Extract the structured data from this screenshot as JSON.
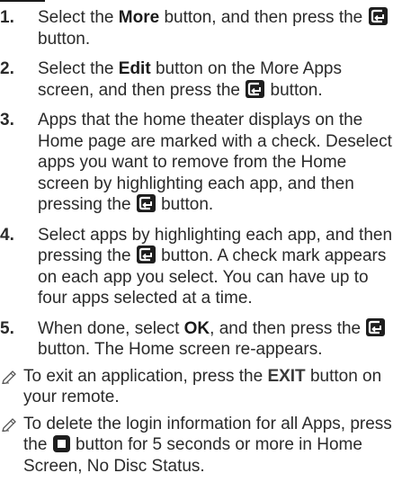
{
  "steps": [
    {
      "number": "1.",
      "p1": "Select the ",
      "b1": "More",
      "p2": " button, and then press the ",
      "p3": " button."
    },
    {
      "number": "2.",
      "p1": "Select the ",
      "b1": "Edit",
      "p2": " button on the More Apps screen, and then press the ",
      "p3": " button."
    },
    {
      "number": "3.",
      "p1": "Apps that the home theater displays on the Home page are marked with a check. Deselect apps you want to remove from the Home screen by highlighting each app, and then pressing the ",
      "p2": " button."
    },
    {
      "number": "4.",
      "p1": "Select apps by highlighting each app, and then pressing the ",
      "p2": " button. A check mark appears on each app you select. You can have up to four apps selected at a time."
    },
    {
      "number": "5.",
      "p1": "When done, select ",
      "b1": "OK",
      "p2": ", and then press the ",
      "p3": " button. The Home screen re-appears."
    }
  ],
  "notes": [
    {
      "p1": "To exit an application, press the ",
      "b1": "EXIT",
      "p2": " button on your remote."
    },
    {
      "p1": "To delete the login information for all Apps, press the ",
      "p2": " button for 5 seconds or more in Home Screen, No Disc Status."
    }
  ],
  "icons": {
    "enter_button": "enter-button-icon",
    "stop_button": "stop-button-icon",
    "note_marker": "pencil-note-icon"
  }
}
